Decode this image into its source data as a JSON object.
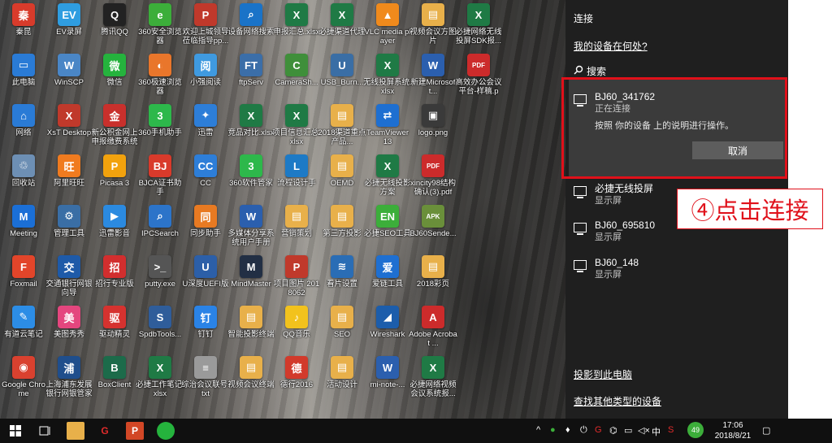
{
  "desktop": {
    "icons": [
      {
        "label": "秦昆",
        "color": "#d83b2b",
        "glyph": "秦"
      },
      {
        "label": "此电脑",
        "color": "#2a7bd6",
        "glyph": "▭"
      },
      {
        "label": "网络",
        "color": "#2a7bd6",
        "glyph": "⌂"
      },
      {
        "label": "回收站",
        "color": "#6d8fb4",
        "glyph": "♲"
      },
      {
        "label": "Meeting",
        "color": "#1b6fd6",
        "glyph": "M"
      },
      {
        "label": "Foxmail",
        "color": "#e2452a",
        "glyph": "F"
      },
      {
        "label": "有道云笔记",
        "color": "#2c8de6",
        "glyph": "✎"
      },
      {
        "label": "Google Chrome",
        "color": "#d9412f",
        "glyph": "◉"
      },
      {
        "label": "EV录屏",
        "color": "#2f9de0",
        "glyph": "EV"
      },
      {
        "label": "WinSCP",
        "color": "#4a86c6",
        "glyph": "W"
      },
      {
        "label": "XsT Desktop",
        "color": "#c0392b",
        "glyph": "X"
      },
      {
        "label": "阿里旺旺",
        "color": "#f07b1f",
        "glyph": "旺"
      },
      {
        "label": "管理工具",
        "color": "#3a6ea5",
        "glyph": "⚙"
      },
      {
        "label": "交通银行网银向导",
        "color": "#1e5aa8",
        "glyph": "交"
      },
      {
        "label": "美图秀秀",
        "color": "#e4467e",
        "glyph": "美"
      },
      {
        "label": "上海浦东发展银行网银管家",
        "color": "#1f4e8c",
        "glyph": "浦"
      },
      {
        "label": "腾讯QQ",
        "color": "#222222",
        "glyph": "Q"
      },
      {
        "label": "微信",
        "color": "#25b33d",
        "glyph": "微"
      },
      {
        "label": "新公积金网上申报缴费系统",
        "color": "#c9302c",
        "glyph": "金"
      },
      {
        "label": "Picasa 3",
        "color": "#f2a20d",
        "glyph": "P"
      },
      {
        "label": "迅雷影音",
        "color": "#2b8ae0",
        "glyph": "▶"
      },
      {
        "label": "招行专业版",
        "color": "#d22e2e",
        "glyph": "招"
      },
      {
        "label": "驱动精灵",
        "color": "#d6322f",
        "glyph": "驱"
      },
      {
        "label": "BoxClient",
        "color": "#1c6b4a",
        "glyph": "B"
      },
      {
        "label": "360安全浏览器",
        "color": "#3cae3a",
        "glyph": "e"
      },
      {
        "label": "360极速浏览器",
        "color": "#e9762b",
        "glyph": "◐"
      },
      {
        "label": "360手机助手",
        "color": "#2db84b",
        "glyph": "3"
      },
      {
        "label": "BJCA证书助手",
        "color": "#d93a2b",
        "glyph": "BJ"
      },
      {
        "label": "IPCSearch",
        "color": "#2c74c9",
        "glyph": "⌕"
      },
      {
        "label": "putty.exe",
        "color": "#555555",
        "glyph": ">_"
      },
      {
        "label": "SpdbTools...",
        "color": "#2f5d9a",
        "glyph": "S"
      },
      {
        "label": "必捷工作笔记.xlsx",
        "color": "#1f7a45",
        "glyph": "X"
      },
      {
        "label": "欢迎上城领导莅临指导pp...",
        "color": "#c0392b",
        "glyph": "P"
      },
      {
        "label": "小强阅读",
        "color": "#3f9ae0",
        "glyph": "阅"
      },
      {
        "label": "迅雷",
        "color": "#2d7ed8",
        "glyph": "✦"
      },
      {
        "label": "CC",
        "color": "#2d7ed8",
        "glyph": "CC"
      },
      {
        "label": "同步助手",
        "color": "#e87a22",
        "glyph": "同"
      },
      {
        "label": "U深度UEFI版",
        "color": "#2c5fa8",
        "glyph": "U"
      },
      {
        "label": "钉钉",
        "color": "#2a83e6",
        "glyph": "钉"
      },
      {
        "label": "综治会议联号.txt",
        "color": "#9a9a9a",
        "glyph": "≡"
      },
      {
        "label": "设备网络搜索",
        "color": "#1a73c8",
        "glyph": "⌕"
      },
      {
        "label": "ftpServ",
        "color": "#3b6ea8",
        "glyph": "FT"
      },
      {
        "label": "竞品对比.xlsx",
        "color": "#1f7a45",
        "glyph": "X"
      },
      {
        "label": "360软件管家",
        "color": "#2db84b",
        "glyph": "3"
      },
      {
        "label": "多媒体分享系统用户手册",
        "color": "#2b5fae",
        "glyph": "W"
      },
      {
        "label": "MindMaster",
        "color": "#222f44",
        "glyph": "M"
      },
      {
        "label": "智能投影终端",
        "color": "#e8b04a",
        "glyph": "▤"
      },
      {
        "label": "视频会议终端",
        "color": "#e8b04a",
        "glyph": "▤"
      },
      {
        "label": "申报汇总.xlsx",
        "color": "#1f7a45",
        "glyph": "X"
      },
      {
        "label": "CameraSh...",
        "color": "#3f8f3a",
        "glyph": "C"
      },
      {
        "label": "项目信息汇总.xlsx",
        "color": "#1f7a45",
        "glyph": "X"
      },
      {
        "label": "流程设计手",
        "color": "#1d7ac6",
        "glyph": "L"
      },
      {
        "label": "营销策划",
        "color": "#e8b04a",
        "glyph": "▤"
      },
      {
        "label": "项目图片 2018062",
        "color": "#c0392b",
        "glyph": "P"
      },
      {
        "label": "QQ音乐",
        "color": "#f2c21d",
        "glyph": "♪"
      },
      {
        "label": "德行2016",
        "color": "#d23a2b",
        "glyph": "德"
      },
      {
        "label": "必捷渠道代理",
        "color": "#1f7a45",
        "glyph": "X"
      },
      {
        "label": "USB_Burn...",
        "color": "#3a6ea5",
        "glyph": "U"
      },
      {
        "label": "2018渠道重点产品...",
        "color": "#e8b04a",
        "glyph": "▤"
      },
      {
        "label": "OEMD",
        "color": "#e8b04a",
        "glyph": "▤"
      },
      {
        "label": "第三方投影",
        "color": "#e8b04a",
        "glyph": "▤"
      },
      {
        "label": "看片设置",
        "color": "#2a6db5",
        "glyph": "≋"
      },
      {
        "label": "SEO",
        "color": "#e8b04a",
        "glyph": "▤"
      },
      {
        "label": "活动设计",
        "color": "#e8b04a",
        "glyph": "▤"
      },
      {
        "label": "VLC media player",
        "color": "#f08a1c",
        "glyph": "▲"
      },
      {
        "label": "无线投屏系统.xlsx",
        "color": "#1f7a45",
        "glyph": "X"
      },
      {
        "label": "TeamViewer 13",
        "color": "#1e6fd1",
        "glyph": "⇄"
      },
      {
        "label": "必捷无线投影方案",
        "color": "#1f7a45",
        "glyph": "X"
      },
      {
        "label": "必捷SEO工具",
        "color": "#3cae3a",
        "glyph": "EN"
      },
      {
        "label": "爱链工具",
        "color": "#1e6fd1",
        "glyph": "爱"
      },
      {
        "label": "Wireshark",
        "color": "#1c5dab",
        "glyph": "◢"
      },
      {
        "label": "mi-note-...",
        "color": "#2b5fae",
        "glyph": "W"
      },
      {
        "label": "视频会议方图片",
        "color": "#e8b04a",
        "glyph": "▤"
      },
      {
        "label": "新建Microsoft...",
        "color": "#2b5fae",
        "glyph": "W"
      },
      {
        "label": "logo.png",
        "color": "#3a3a3a",
        "glyph": "▣"
      },
      {
        "label": "xincity98结构确认(3).pdf",
        "color": "#cc2b2b",
        "glyph": "PDF"
      },
      {
        "label": "BJ60Sende...",
        "color": "#6a8f3a",
        "glyph": "APK"
      },
      {
        "label": "2018彩页",
        "color": "#e8b04a",
        "glyph": "▤"
      },
      {
        "label": "Adobe Acrobat ...",
        "color": "#cc2b2b",
        "glyph": "A"
      },
      {
        "label": "必捷网络视频会议系统报...",
        "color": "#1f7a45",
        "glyph": "X"
      },
      {
        "label": "必捷网络无线投屏SDK报...",
        "color": "#1f7a45",
        "glyph": "X"
      },
      {
        "label": "高效办公会议平台-样稿.p",
        "color": "#cc2b2b",
        "glyph": "PDF"
      }
    ]
  },
  "panel": {
    "title": "连接",
    "find_device_link": "我的设备在何处?",
    "search_label": "搜索",
    "selected_device": {
      "name": "BJ60_341762",
      "status": "正在连接",
      "instruction": "按照 你的设备 上的说明进行操作。",
      "cancel_label": "取消"
    },
    "devices": [
      {
        "name": "必捷无线投屏",
        "type": "显示屏"
      },
      {
        "name": "BJ60_695810",
        "type": "显示屏"
      },
      {
        "name": "BJ60_148",
        "type": "显示屏"
      }
    ],
    "project_link": "投影到此电脑",
    "other_link": "查找其他类型的设备"
  },
  "annotation": {
    "text": "④点击连接",
    "color": "#e0101a"
  },
  "taskbar": {
    "input_method": "中",
    "badge": "49",
    "time": "17:06",
    "date": "2018/8/21"
  }
}
